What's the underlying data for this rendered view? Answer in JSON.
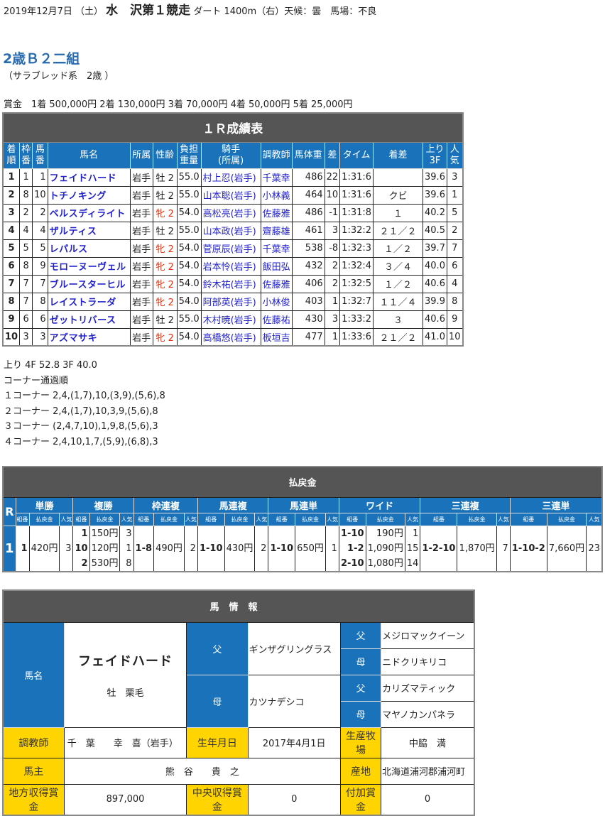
{
  "header": {
    "date": "2019年12月7日 （土）",
    "venue": "水　沢第１競走",
    "conditions": "ダート 1400m（右）天候：曇　馬場：不良"
  },
  "race": {
    "name": "2歳Ｂ２二組",
    "category": "（サラブレッド系　2歳 ）",
    "prize": "賞金　1着 500,000円  2着 130,000円  3着 70,000円  4着 50,000円  5着 25,000円"
  },
  "results": {
    "title": "１Ｒ成績表",
    "headers": [
      "着\n順",
      "枠\n番",
      "馬\n番",
      "馬名",
      "所属",
      "性齢",
      "負担\n重量",
      "騎手\n(所属)",
      "調教師",
      "馬体重",
      "差",
      "タイム",
      "着差",
      "上り\n3F",
      "人\n気"
    ],
    "rows": [
      {
        "pos": "1",
        "waku": "1",
        "num": "1",
        "name": "フェイドハード",
        "aff": "岩手",
        "sex": "牡 2",
        "mare": false,
        "wt": "55.0",
        "jockey": "村上忍(岩手)",
        "trainer": "千葉幸",
        "bw": "486",
        "diff": "22",
        "time": "1:31:6",
        "margin": "",
        "f3": "39.6",
        "pop": "3"
      },
      {
        "pos": "2",
        "waku": "8",
        "num": "10",
        "name": "トチノキング",
        "aff": "岩手",
        "sex": "牡 2",
        "mare": false,
        "wt": "55.0",
        "jockey": "山本聡(岩手)",
        "trainer": "小林義",
        "bw": "464",
        "diff": "10",
        "time": "1:31:6",
        "margin": "クビ",
        "f3": "39.6",
        "pop": "1"
      },
      {
        "pos": "3",
        "waku": "2",
        "num": "2",
        "name": "ベルスディライト",
        "aff": "岩手",
        "sex": "牝 2",
        "mare": true,
        "wt": "54.0",
        "jockey": "高松亮(岩手)",
        "trainer": "佐藤雅",
        "bw": "486",
        "diff": "-1",
        "time": "1:31:8",
        "margin": "１",
        "f3": "40.2",
        "pop": "5"
      },
      {
        "pos": "4",
        "waku": "4",
        "num": "4",
        "name": "ザルティス",
        "aff": "岩手",
        "sex": "牡 2",
        "mare": false,
        "wt": "55.0",
        "jockey": "山本政(岩手)",
        "trainer": "齋藤雄",
        "bw": "461",
        "diff": "3",
        "time": "1:32:2",
        "margin": "２１／２",
        "f3": "40.5",
        "pop": "2"
      },
      {
        "pos": "5",
        "waku": "5",
        "num": "5",
        "name": "レパルス",
        "aff": "岩手",
        "sex": "牝 2",
        "mare": true,
        "wt": "54.0",
        "jockey": "菅原辰(岩手)",
        "trainer": "千葉幸",
        "bw": "538",
        "diff": "-8",
        "time": "1:32:3",
        "margin": "１／２",
        "f3": "39.7",
        "pop": "7"
      },
      {
        "pos": "6",
        "waku": "8",
        "num": "9",
        "name": "モローヌーヴェル",
        "aff": "岩手",
        "sex": "牝 2",
        "mare": true,
        "wt": "54.0",
        "jockey": "岩本怜(岩手)",
        "trainer": "飯田弘",
        "bw": "432",
        "diff": "2",
        "time": "1:32:4",
        "margin": "３／４",
        "f3": "40.0",
        "pop": "6"
      },
      {
        "pos": "7",
        "waku": "7",
        "num": "7",
        "name": "ブルースターヒル",
        "aff": "岩手",
        "sex": "牝 2",
        "mare": true,
        "wt": "54.0",
        "jockey": "鈴木祐(岩手)",
        "trainer": "佐藤雅",
        "bw": "406",
        "diff": "2",
        "time": "1:32:5",
        "margin": "１／２",
        "f3": "40.6",
        "pop": "4"
      },
      {
        "pos": "8",
        "waku": "7",
        "num": "8",
        "name": "レイストラーダ",
        "aff": "岩手",
        "sex": "牝 2",
        "mare": true,
        "wt": "54.0",
        "jockey": "阿部英(岩手)",
        "trainer": "小林俊",
        "bw": "403",
        "diff": "1",
        "time": "1:32:7",
        "margin": "１１／４",
        "f3": "39.9",
        "pop": "8"
      },
      {
        "pos": "9",
        "waku": "6",
        "num": "6",
        "name": "ゼットリバース",
        "aff": "岩手",
        "sex": "牡 2",
        "mare": false,
        "wt": "55.0",
        "jockey": "木村暁(岩手)",
        "trainer": "佐藤祐",
        "bw": "430",
        "diff": "3",
        "time": "1:33:2",
        "margin": "３",
        "f3": "40.6",
        "pop": "9"
      },
      {
        "pos": "10",
        "waku": "3",
        "num": "3",
        "name": "アズマサキ",
        "aff": "岩手",
        "sex": "牝 2",
        "mare": true,
        "wt": "54.0",
        "jockey": "高橋悠(岩手)",
        "trainer": "板垣吉",
        "bw": "477",
        "diff": "1",
        "time": "1:33:6",
        "margin": "２１／２",
        "f3": "41.0",
        "pop": "10"
      }
    ]
  },
  "notes": {
    "last_split": "上り 4F 52.8 3F 40.0",
    "corner_title": "コーナー通過順",
    "corners": [
      "１コーナー 2,4,(1,7),10,(3,9),(5,6),8",
      "２コーナー 2,4,(1,7),10,3,9,(5,6),8",
      "３コーナー (2,4,7,10),1,9,8,(5,6),3",
      "４コーナー 2,4,10,1,7,(5,9),(6,8),3"
    ]
  },
  "payout": {
    "title": "払戻金",
    "r_label": "R",
    "race_no": "1",
    "sub_labels": {
      "combo": "組番",
      "amount": "払戻金",
      "pop": "人気"
    },
    "bets": [
      {
        "type": "単勝",
        "entries": [
          {
            "combo": "1",
            "amount": "420円",
            "pop": "3"
          }
        ]
      },
      {
        "type": "複勝",
        "entries": [
          {
            "combo": "1",
            "amount": "150円",
            "pop": "3"
          },
          {
            "combo": "10",
            "amount": "120円",
            "pop": "1"
          },
          {
            "combo": "2",
            "amount": "530円",
            "pop": "8"
          }
        ]
      },
      {
        "type": "枠連複",
        "entries": [
          {
            "combo": "1-8",
            "amount": "490円",
            "pop": "2"
          }
        ]
      },
      {
        "type": "馬連複",
        "entries": [
          {
            "combo": "1-10",
            "amount": "430円",
            "pop": "2"
          }
        ]
      },
      {
        "type": "馬連単",
        "entries": [
          {
            "combo": "1-10",
            "amount": "650円",
            "pop": "1"
          }
        ]
      },
      {
        "type": "ワイド",
        "entries": [
          {
            "combo": "1-10",
            "amount": "190円",
            "pop": "1"
          },
          {
            "combo": "1-2",
            "amount": "1,090円",
            "pop": "15"
          },
          {
            "combo": "2-10",
            "amount": "1,080円",
            "pop": "14"
          }
        ]
      },
      {
        "type": "三連複",
        "entries": [
          {
            "combo": "1-2-10",
            "amount": "1,870円",
            "pop": "7"
          }
        ]
      },
      {
        "type": "三連単",
        "entries": [
          {
            "combo": "1-10-2",
            "amount": "7,660円",
            "pop": "23"
          }
        ]
      }
    ]
  },
  "horse_info": {
    "title": "馬情報",
    "name_label": "馬名",
    "horse_name": "フェイドハード",
    "sex_color": "牡　栗毛",
    "sire_label": "父",
    "dam_label": "母",
    "sire": "ギンザグリングラス",
    "dam": "カツナデシコ",
    "sire_sire": "メジロマックイーン",
    "sire_dam": "ニドクリキリコ",
    "dam_sire": "カリズマティック",
    "dam_dam": "マヤノカンパネラ",
    "trainer_label": "調教師",
    "trainer": "千　葉　　幸　喜（岩手）",
    "birth_label": "生年月日",
    "birth": "2017年4月1日",
    "farm_label": "生産牧場",
    "farm": "中脇　満",
    "owner_label": "馬主",
    "owner": "熊　谷　　貴　之",
    "origin_label": "産地",
    "origin": "北海道浦河郡浦河町",
    "local_prize_label": "地方収得賞金",
    "local_prize": "897,000",
    "central_prize_label": "中央収得賞金",
    "central_prize": "0",
    "extra_prize_label": "付加賞金",
    "extra_prize": "0"
  },
  "colors": {
    "header_dark": "#555555",
    "header_blue": "#1a73ba",
    "label_yellow": "#ffd400",
    "link_blue": "#2222cc",
    "mare_red": "#e03010",
    "race_title_blue": "#2a6bb0"
  }
}
